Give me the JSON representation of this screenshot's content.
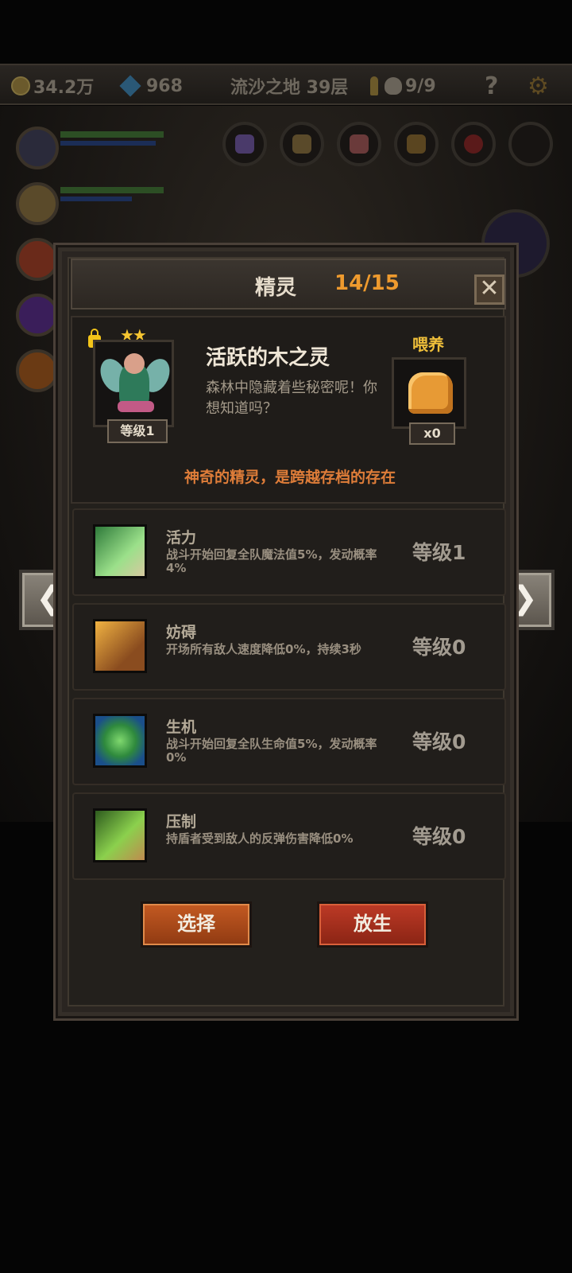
{
  "topbar": {
    "gold": "34.2万",
    "gems": "968",
    "location": "流沙之地 39层",
    "keys_skulls": "9/9",
    "help": "?",
    "settings": "⚙"
  },
  "panel": {
    "title": "精灵",
    "count": "14/15",
    "close": "✕"
  },
  "spirit": {
    "name": "活跃的木之灵",
    "description": "森林中隐藏着些秘密呢！你想知道吗？",
    "level": "等级1",
    "stars": "★★",
    "feed_label": "喂养",
    "feed_count": "x0",
    "tagline": "神奇的精灵，是跨越存档的存在"
  },
  "skills": [
    {
      "name": "活力",
      "desc": "战斗开始回复全队魔法值5%，发动概率4%",
      "level": "等级1",
      "icon": "vitality-icon"
    },
    {
      "name": "妨碍",
      "desc": "开场所有敌人速度降低0%，持续3秒",
      "level": "等级0",
      "icon": "chain-boot-icon"
    },
    {
      "name": "生机",
      "desc": "战斗开始回复全队生命值5%，发动概率0%",
      "level": "等级0",
      "icon": "leaf-icon"
    },
    {
      "name": "压制",
      "desc": "持盾者受到敌人的反弹伤害降低0%",
      "level": "等级0",
      "icon": "claw-icon"
    }
  ],
  "buttons": {
    "select": "选择",
    "release": "放生"
  },
  "nav": {
    "prev": "❮",
    "next": "❯"
  },
  "colors": {
    "accent_orange": "#ee9a2e",
    "tagline": "#df7d39",
    "feed_label": "#efbf3a",
    "select_button": "#c45a22",
    "release_button": "#bd3a26"
  }
}
